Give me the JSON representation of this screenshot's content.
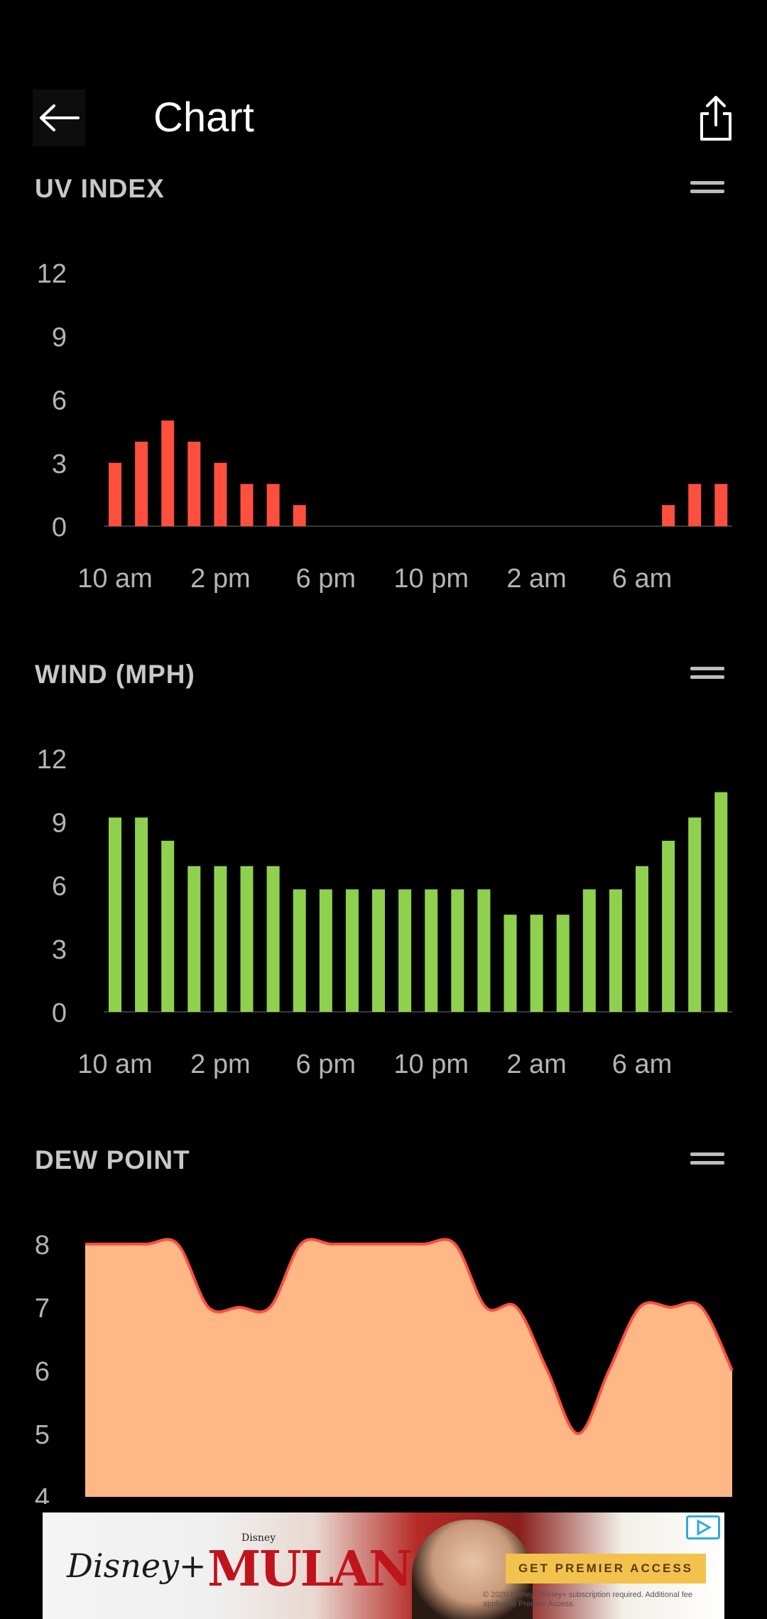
{
  "header": {
    "title": "Chart"
  },
  "sections": [
    {
      "title": "UV INDEX"
    },
    {
      "title": "WIND (MPH)"
    },
    {
      "title": "DEW POINT"
    }
  ],
  "chart_data": [
    {
      "type": "bar",
      "name": "uv",
      "color": "#ff4f3f",
      "yticks": [
        "0",
        "3",
        "6",
        "9",
        "12"
      ],
      "ylim": [
        0,
        12
      ],
      "xticks": [
        "10 am",
        "2 pm",
        "6 pm",
        "10 pm",
        "2 am",
        "6 am"
      ],
      "values": [
        3,
        4,
        5,
        4,
        3,
        2,
        2,
        1,
        0,
        0,
        0,
        0,
        0,
        0,
        0,
        0,
        0,
        0,
        0,
        0,
        0,
        1,
        2,
        2
      ]
    },
    {
      "type": "bar",
      "name": "wind",
      "color": "#8fd14f",
      "yticks": [
        "0",
        "3",
        "6",
        "9",
        "12"
      ],
      "ylim": [
        0,
        12
      ],
      "xticks": [
        "10 am",
        "2 pm",
        "6 pm",
        "10 pm",
        "2 am",
        "6 am"
      ],
      "values": [
        9.2,
        9.2,
        8.1,
        6.9,
        6.9,
        6.9,
        6.9,
        5.8,
        5.8,
        5.8,
        5.8,
        5.8,
        5.8,
        5.8,
        5.8,
        4.6,
        4.6,
        4.6,
        5.8,
        5.8,
        6.9,
        8.1,
        9.2,
        10.4
      ]
    },
    {
      "type": "area",
      "name": "dew",
      "color": "#ffb785",
      "line_color": "#ff4f3f",
      "yticks": [
        "4",
        "5",
        "6",
        "7",
        "8"
      ],
      "ylim": [
        4,
        8
      ],
      "values": [
        8,
        8,
        8,
        8,
        7,
        7,
        7,
        8,
        8,
        8,
        8,
        8,
        8,
        7,
        7,
        6,
        5,
        6,
        7,
        7,
        7,
        6
      ]
    }
  ],
  "ad": {
    "brand": "Disney+",
    "disney_small": "Disney",
    "movie": "MULAN",
    "cta": "GET PREMIER ACCESS",
    "legal": "© 2020 Disney. Disney+ subscription required. Additional fee applies to Premier Access."
  }
}
